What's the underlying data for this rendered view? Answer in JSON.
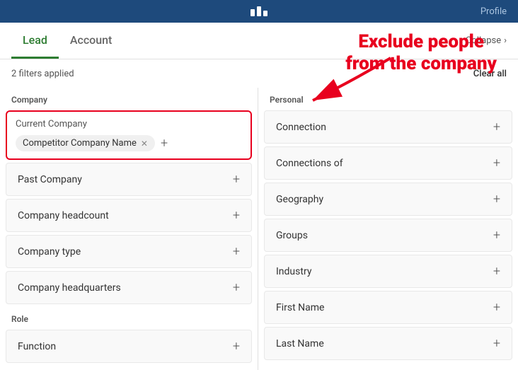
{
  "topbar": {
    "right_label": "Profile"
  },
  "tabs": [
    {
      "id": "lead",
      "label": "Lead",
      "active": true
    },
    {
      "id": "account",
      "label": "Account",
      "active": false
    }
  ],
  "collapse_label": "Collapse",
  "filters_applied": "2 filters applied",
  "clear_all_label": "Clear all",
  "annotation": {
    "line1": "Exclude people",
    "line2": "from the company"
  },
  "left_column": {
    "sections": [
      {
        "header": "Company",
        "items": [
          {
            "id": "current-company",
            "label": "Current Company",
            "type": "tag-input",
            "tags": [
              {
                "label": "Competitor Company Name"
              }
            ]
          },
          {
            "id": "past-company",
            "label": "Past Company",
            "type": "expandable"
          },
          {
            "id": "company-headcount",
            "label": "Company headcount",
            "type": "expandable"
          },
          {
            "id": "company-type",
            "label": "Company type",
            "type": "expandable"
          },
          {
            "id": "company-headquarters",
            "label": "Company headquarters",
            "type": "expandable"
          }
        ]
      },
      {
        "header": "Role",
        "items": [
          {
            "id": "function",
            "label": "Function",
            "type": "expandable"
          }
        ]
      }
    ]
  },
  "right_column": {
    "sections": [
      {
        "header": "Personal",
        "items": [
          {
            "id": "connection",
            "label": "Connection"
          },
          {
            "id": "connections-of",
            "label": "Connections of"
          },
          {
            "id": "geography",
            "label": "Geography"
          },
          {
            "id": "groups",
            "label": "Groups"
          },
          {
            "id": "industry",
            "label": "Industry"
          },
          {
            "id": "first-name",
            "label": "First Name"
          },
          {
            "id": "last-name",
            "label": "Last Name"
          }
        ]
      }
    ]
  }
}
